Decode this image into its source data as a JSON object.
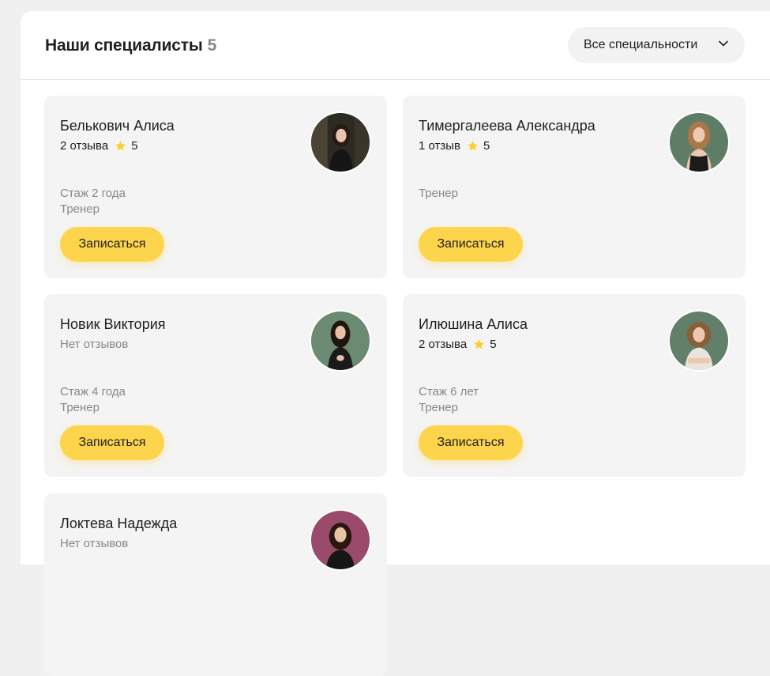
{
  "header": {
    "title": "Наши специалисты",
    "count": "5",
    "filter_label": "Все специальности"
  },
  "specialists": [
    {
      "name": "Белькович Алиса",
      "reviews": "2 отзыва",
      "rating": "5",
      "experience": "Стаж 2 года",
      "role": "Тренер",
      "button": "Записаться"
    },
    {
      "name": "Тимергалеева Александра",
      "reviews": "1 отзыв",
      "rating": "5",
      "experience": "",
      "role": "Тренер",
      "button": "Записаться"
    },
    {
      "name": "Новик Виктория",
      "reviews": "Нет отзывов",
      "rating": "",
      "experience": "Стаж 4 года",
      "role": "Тренер",
      "button": "Записаться"
    },
    {
      "name": "Илюшина Алиса",
      "reviews": "2 отзыва",
      "rating": "5",
      "experience": "Стаж 6 лет",
      "role": "Тренер",
      "button": "Записаться"
    },
    {
      "name": "Локтева Надежда",
      "reviews": "Нет отзывов",
      "rating": ""
    }
  ],
  "colors": {
    "accent": "#fdd54d",
    "card_bg": "#f4f4f4",
    "muted_text": "#8a8784",
    "star": "#fccd2e"
  }
}
